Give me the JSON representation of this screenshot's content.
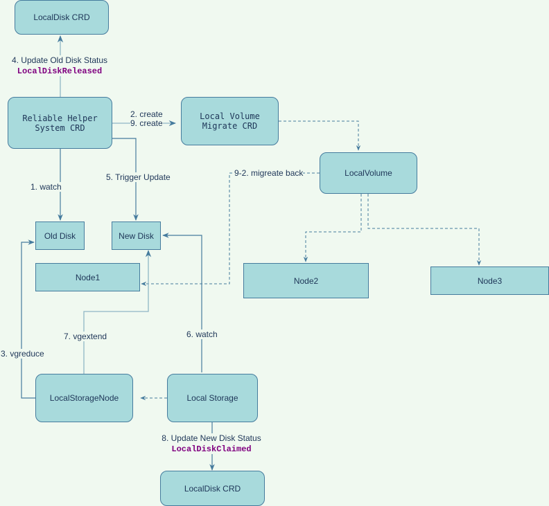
{
  "colors": {
    "background": "#f0f9f0",
    "node_fill": "#a8dadc",
    "node_stroke": "#457b9d",
    "text": "#1d3557",
    "status_text": "#800080",
    "edge": "#457b9d",
    "edge_light": "#8fb6c6"
  },
  "nodes": {
    "localdisk_crd_top": "LocalDisk CRD",
    "reliable_helper": "Reliable Helper\nSystem CRD",
    "local_volume_migrate": "Local Volume\nMigrate CRD",
    "local_volume": "LocalVolume",
    "old_disk": "Old Disk",
    "new_disk": "New Disk",
    "node1": "Node1",
    "node2": "Node2",
    "node3": "Node3",
    "local_storage_node": "LocalStorageNode",
    "local_storage": "Local Storage",
    "localdisk_crd_bottom": "LocalDisk CRD"
  },
  "edges": {
    "update_old_disk": {
      "label": "4. Update Old Disk Status",
      "status": "LocalDiskReleased"
    },
    "create": {
      "label": "2. create\n9. create"
    },
    "watch_old": {
      "label": "1. watch"
    },
    "trigger_update": {
      "label": "5. Trigger Update"
    },
    "migrate_back": {
      "label": "9-2. migreate back"
    },
    "vgreduce": {
      "label": "3. vgreduce"
    },
    "vgextend": {
      "label": "7. vgextend"
    },
    "watch_new": {
      "label": "6. watch"
    },
    "update_new_disk": {
      "label": "8. Update New Disk Status",
      "status": "LocalDiskClaimed"
    }
  }
}
